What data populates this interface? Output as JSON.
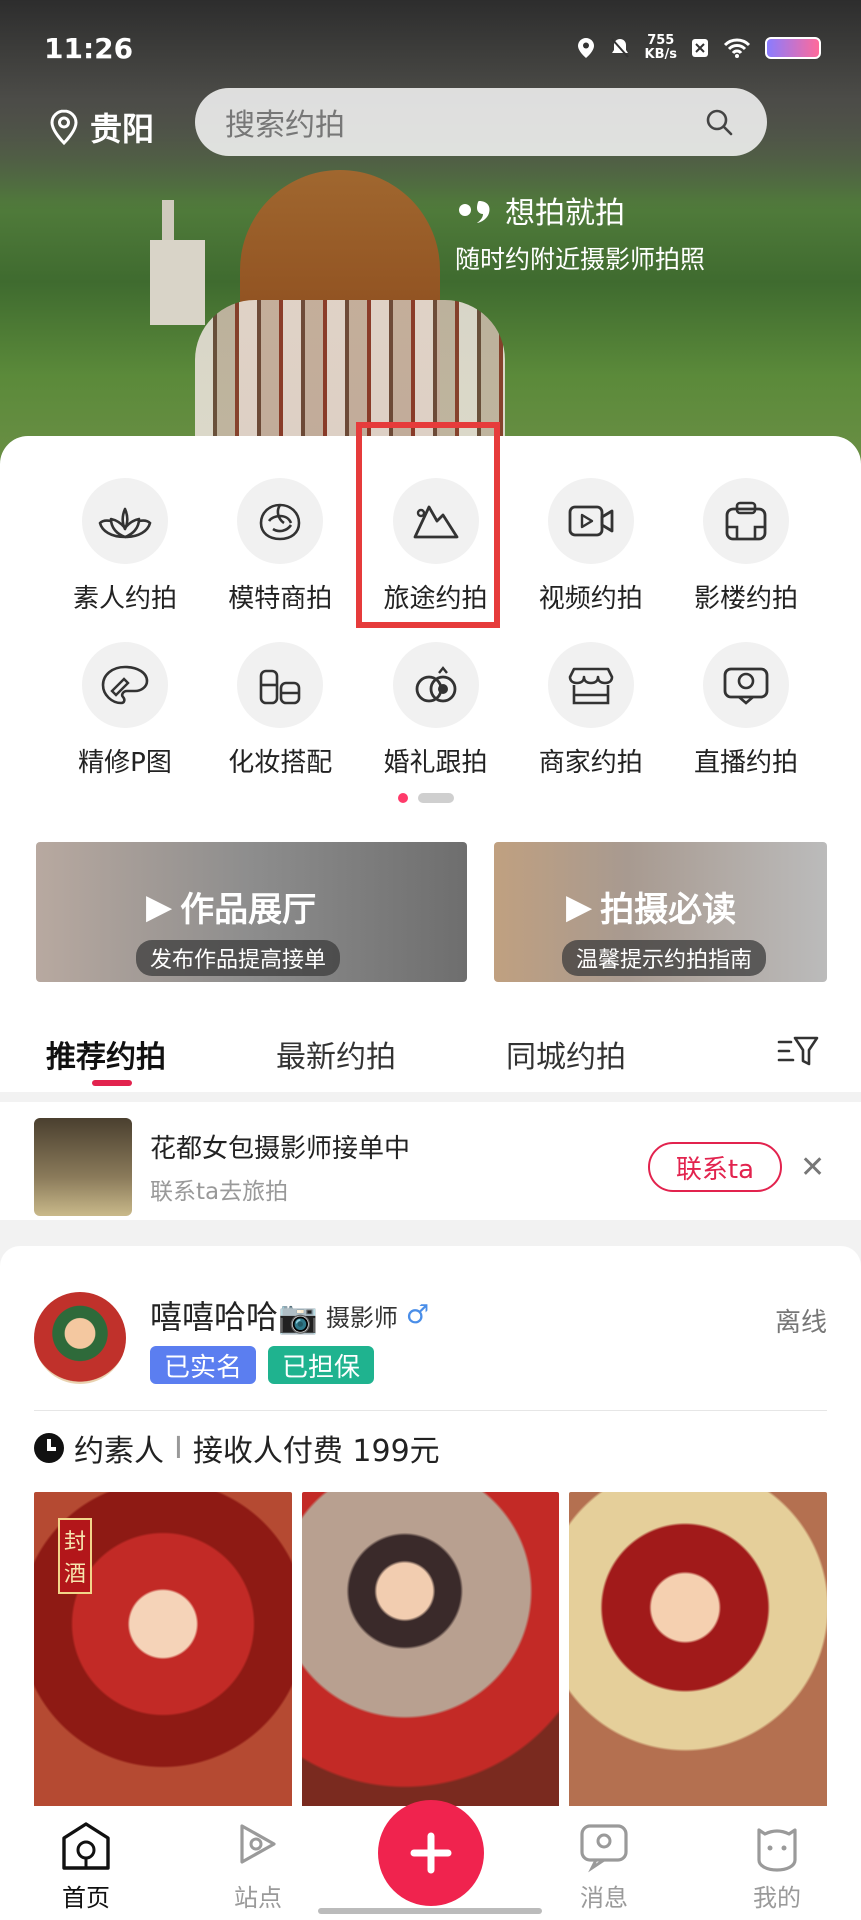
{
  "status": {
    "time": "11:26",
    "speed_value": "755",
    "speed_unit": "KB/s"
  },
  "top": {
    "location": "贵阳",
    "search_placeholder": "搜索约拍"
  },
  "slogan": {
    "line1": "想拍就拍",
    "line2": "随时约附近摄影师拍照"
  },
  "categories": {
    "row1": [
      {
        "label": "素人约拍",
        "icon": "lotus-icon"
      },
      {
        "label": "模特商拍",
        "icon": "rose-icon"
      },
      {
        "label": "旅途约拍",
        "icon": "mountain-icon"
      },
      {
        "label": "视频约拍",
        "icon": "video-icon"
      },
      {
        "label": "影楼约拍",
        "icon": "studio-icon"
      }
    ],
    "row2": [
      {
        "label": "精修P图",
        "icon": "palette-icon"
      },
      {
        "label": "化妆搭配",
        "icon": "makeup-icon"
      },
      {
        "label": "婚礼跟拍",
        "icon": "rings-icon"
      },
      {
        "label": "商家约拍",
        "icon": "shop-icon"
      },
      {
        "label": "直播约拍",
        "icon": "live-icon"
      }
    ]
  },
  "banners": [
    {
      "title": "作品展厅",
      "subtitle": "发布作品提高接单"
    },
    {
      "title": "拍摄必读",
      "subtitle": "温馨提示约拍指南"
    }
  ],
  "tabs": [
    "推荐约拍",
    "最新约拍",
    "同城约拍"
  ],
  "notice": {
    "title": "花都女包摄影师接单中",
    "subtitle": "联系ta去旅拍",
    "button": "联系ta"
  },
  "post": {
    "name": "嘻嘻哈哈📷",
    "role": "摄影师",
    "gender": "♂",
    "status": "离线",
    "badges": [
      "已实名",
      "已担保"
    ],
    "type": "约素人",
    "separator": "I",
    "price": "接收人付费 199元",
    "photo_tags": [
      "封酒",
      "",
      ""
    ]
  },
  "nav": [
    "首页",
    "站点",
    "消息",
    "我的"
  ],
  "colors": {
    "accent": "#e2234e",
    "plus": "#f0234e",
    "badge_blue": "#5b7ef0",
    "badge_green": "#1fb38f",
    "highlight": "#e63b3b"
  }
}
